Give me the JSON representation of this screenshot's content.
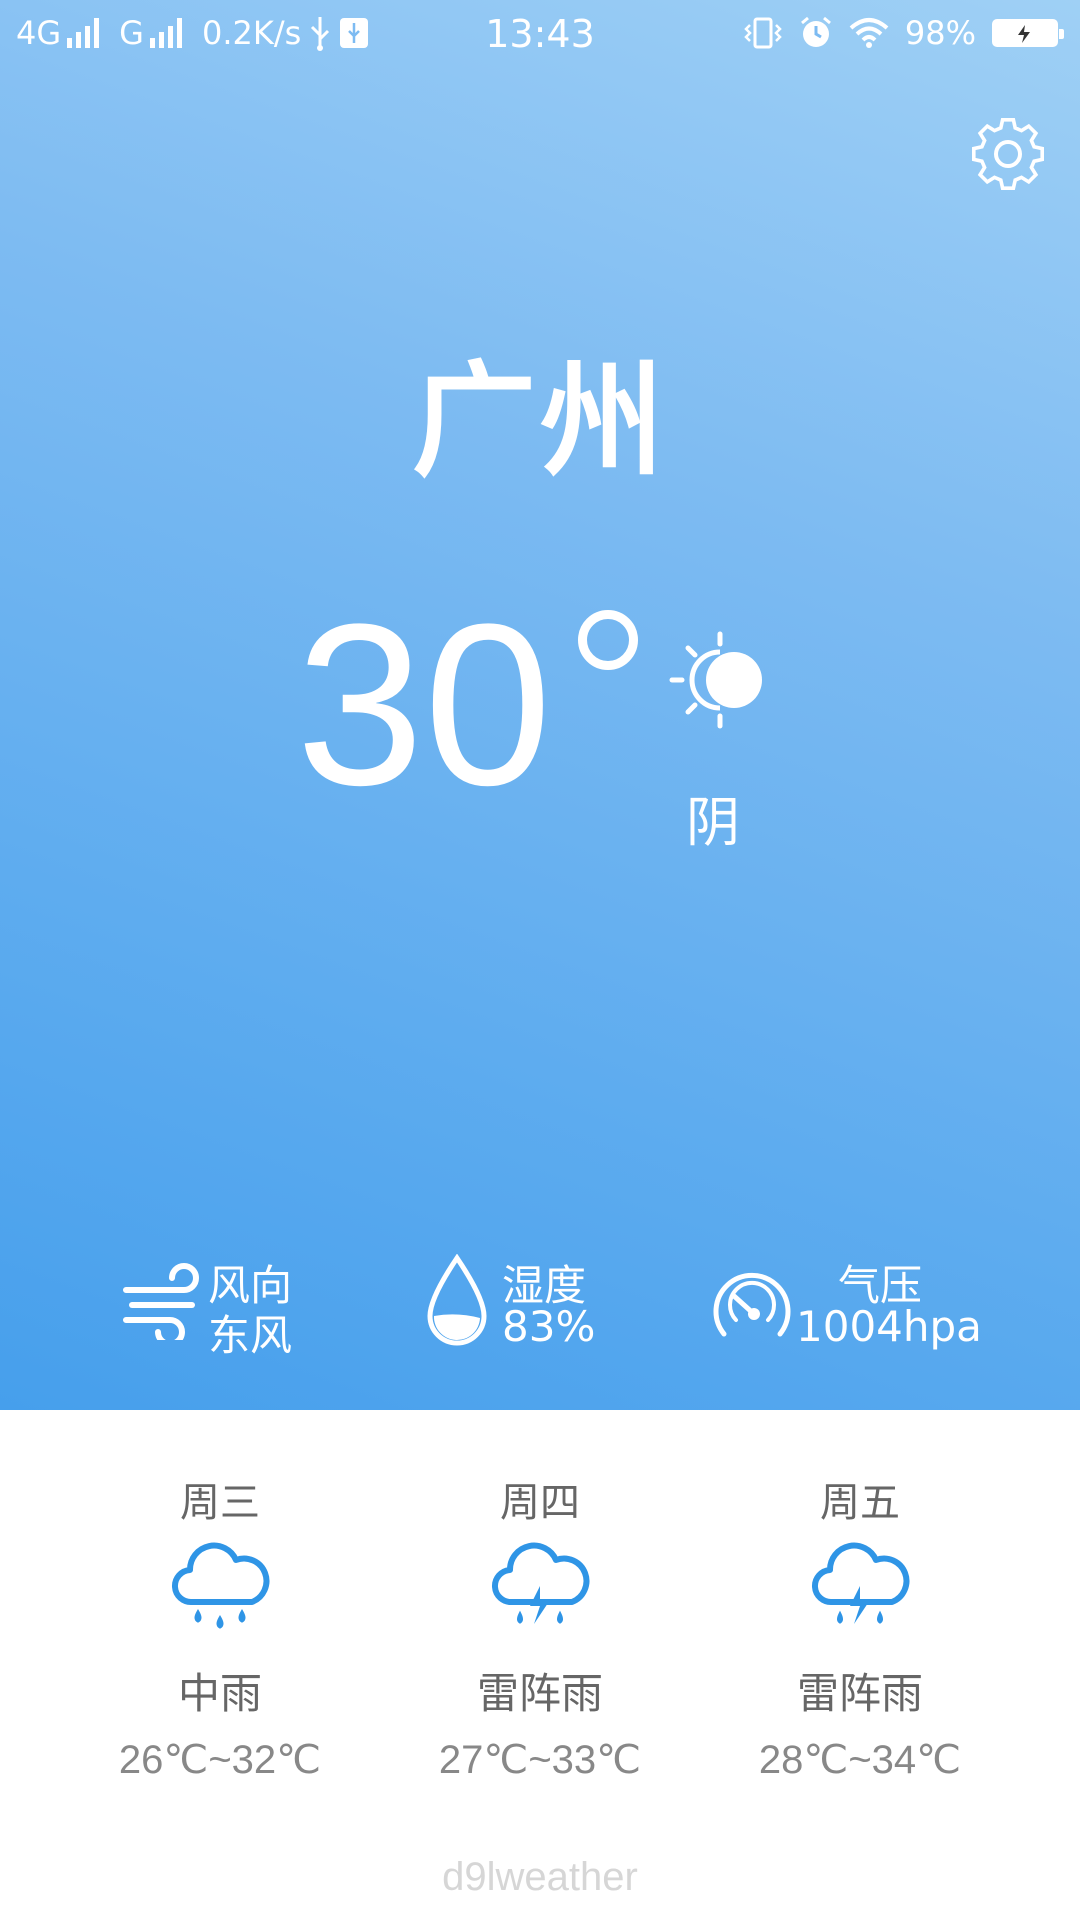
{
  "status_bar": {
    "network_1": "4G",
    "network_2": "G",
    "speed": "0.2K/s",
    "time": "13:43",
    "battery": "98%",
    "icons": [
      "signal-icon",
      "usb-icon",
      "vibrate-icon",
      "alarm-icon",
      "wifi-icon",
      "battery-icon"
    ]
  },
  "current": {
    "city": "广州",
    "temperature": "30",
    "condition": "阴",
    "condition_icon": "cloudy-sun-icon"
  },
  "metrics": {
    "wind": {
      "label": "风向",
      "value": "东风",
      "icon": "wind-icon"
    },
    "humidity": {
      "label": "湿度",
      "value": "83%",
      "icon": "droplet-icon"
    },
    "pressure": {
      "label": "气压",
      "value": "1004hpa",
      "icon": "gauge-icon"
    }
  },
  "forecast": [
    {
      "day": "周三",
      "condition": "中雨",
      "range": "26℃~32℃",
      "icon": "rain-cloud-icon"
    },
    {
      "day": "周四",
      "condition": "雷阵雨",
      "range": "27℃~33℃",
      "icon": "thunder-rain-icon"
    },
    {
      "day": "周五",
      "condition": "雷阵雨",
      "range": "28℃~34℃",
      "icon": "thunder-rain-icon"
    }
  ],
  "footer": "d9lweather",
  "colors": {
    "hero_top": "#9fd0f5",
    "hero_bottom": "#469fec",
    "forecast_icon": "#2f95e6",
    "text_gray": "#666666",
    "footer_gray": "#d6d6d6"
  }
}
